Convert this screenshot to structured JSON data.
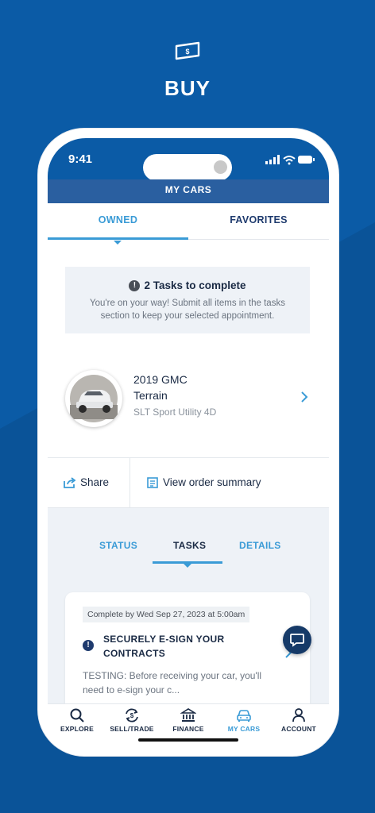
{
  "hero": {
    "title": "BUY",
    "icon": "money-bill-icon"
  },
  "status_bar": {
    "time": "9:41"
  },
  "topbar": {
    "title": "MY CARS"
  },
  "tabs": {
    "owned": "OWNED",
    "favorites": "FAVORITES"
  },
  "tasks_banner": {
    "icon": "exclamation-icon",
    "title": "2 Tasks to complete",
    "subtitle": "You're on your way! Submit all items in the tasks section to keep your selected appointment."
  },
  "car": {
    "year_make": "2019 GMC",
    "model": "Terrain",
    "trim": "SLT Sport Utility 4D"
  },
  "actions": {
    "share": "Share",
    "order_summary": "View order summary"
  },
  "subtabs": {
    "status": "STATUS",
    "tasks": "TASKS",
    "details": "DETAILS"
  },
  "task": {
    "due": "Complete by Wed Sep 27, 2023 at 5:00am",
    "title": "SECURELY E-SIGN YOUR CONTRACTS",
    "description": "TESTING: Before receiving your car, you'll need to e-sign your c..."
  },
  "bottom_nav": [
    {
      "label": "EXPLORE",
      "icon": "search-icon",
      "active": false
    },
    {
      "label": "SELL/TRADE",
      "icon": "swap-dollar-icon",
      "active": false
    },
    {
      "label": "FINANCE",
      "icon": "bank-icon",
      "active": false
    },
    {
      "label": "MY CARS",
      "icon": "car-icon",
      "active": true
    },
    {
      "label": "ACCOUNT",
      "icon": "person-icon",
      "active": false
    }
  ],
  "colors": {
    "background": "#0b5ba6",
    "accent": "#3a9bd6",
    "navy": "#1a2a44"
  }
}
